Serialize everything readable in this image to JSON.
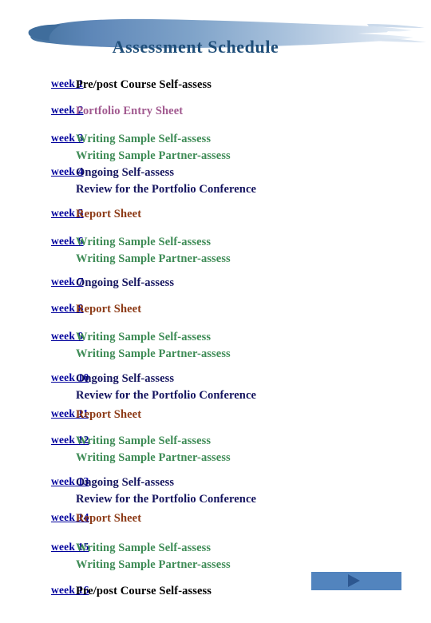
{
  "header": {
    "title": "Assessment Schedule",
    "title_color": "#1f4e79",
    "banner_gradient_from": "#4a7ab5",
    "banner_gradient_to": "#e7eef7"
  },
  "palette": {
    "black": "#000000",
    "purple": "#a1598f",
    "green": "#3d8b55",
    "navy": "#13135e",
    "brown": "#8c3a16",
    "link": "#00009c",
    "nav_bar": "#5284be",
    "nav_arrow": "#2d5790"
  },
  "schedule": {
    "rows": [
      {
        "week": "week 1",
        "gap": 0,
        "tasks": [
          {
            "text": "Pre/post Course Self-assess",
            "color": "black"
          }
        ]
      },
      {
        "week": "week 2",
        "gap": 12,
        "tasks": [
          {
            "text": "Portfolio Entry Sheet",
            "color": "purple"
          }
        ]
      },
      {
        "week": "week 3",
        "gap": 14,
        "tasks": [
          {
            "text": "Writing Sample Self-assess",
            "color": "green"
          },
          {
            "text": "Writing Sample Partner-assess",
            "color": "green"
          }
        ]
      },
      {
        "week": "week 4",
        "gap": 0,
        "tasks": [
          {
            "text": "Ongoing Self-assess",
            "color": "navy"
          },
          {
            "text": "Review for the Portfolio Conference",
            "color": "navy"
          }
        ]
      },
      {
        "week": "week 5",
        "gap": 10,
        "tasks": [
          {
            "text": "Report Sheet",
            "color": "brown"
          }
        ]
      },
      {
        "week": "week 6",
        "gap": 14,
        "tasks": [
          {
            "text": "Writing Sample Self-assess",
            "color": "green"
          },
          {
            "text": "Writing Sample Partner-assess",
            "color": "green"
          }
        ]
      },
      {
        "week": "week 7",
        "gap": 9,
        "tasks": [
          {
            "text": "Ongoing Self-assess",
            "color": "navy"
          }
        ]
      },
      {
        "week": "week 8",
        "gap": 12,
        "tasks": [
          {
            "text": "Report Sheet",
            "color": "brown"
          }
        ]
      },
      {
        "week": "week 9",
        "gap": 14,
        "tasks": [
          {
            "text": "Writing Sample Self-assess",
            "color": "green"
          },
          {
            "text": "Writing Sample Partner-assess",
            "color": "green"
          }
        ]
      },
      {
        "week": "week 10",
        "gap": 10,
        "tasks": [
          {
            "text": "Ongoing Self-assess",
            "color": "navy"
          },
          {
            "text": "Review for the Portfolio Conference",
            "color": "navy"
          }
        ]
      },
      {
        "week": "week 11",
        "gap": 3,
        "tasks": [
          {
            "text": "Report Sheet",
            "color": "brown"
          }
        ]
      },
      {
        "week": "week 12",
        "gap": 12,
        "tasks": [
          {
            "text": "Writing Sample Self-assess",
            "color": "green"
          },
          {
            "text": "Writing Sample Partner-assess",
            "color": "green"
          }
        ]
      },
      {
        "week": "week 13",
        "gap": 10,
        "tasks": [
          {
            "text": "Ongoing Self-assess",
            "color": "navy"
          },
          {
            "text": "Review for the Portfolio Conference",
            "color": "navy"
          }
        ]
      },
      {
        "week": "week 14",
        "gap": 3,
        "tasks": [
          {
            "text": "Report Sheet",
            "color": "brown"
          }
        ]
      },
      {
        "week": "week 15",
        "gap": 16,
        "tasks": [
          {
            "text": "Writing Sample Self-assess",
            "color": "green"
          },
          {
            "text": "Writing Sample Partner-assess",
            "color": "green"
          }
        ]
      },
      {
        "week": "week 16",
        "gap": 12,
        "tasks": [
          {
            "text": "Pre/post Course Self-assess",
            "color": "black"
          }
        ]
      }
    ]
  },
  "footer": {
    "next_icon": "play-triangle-right-icon"
  }
}
